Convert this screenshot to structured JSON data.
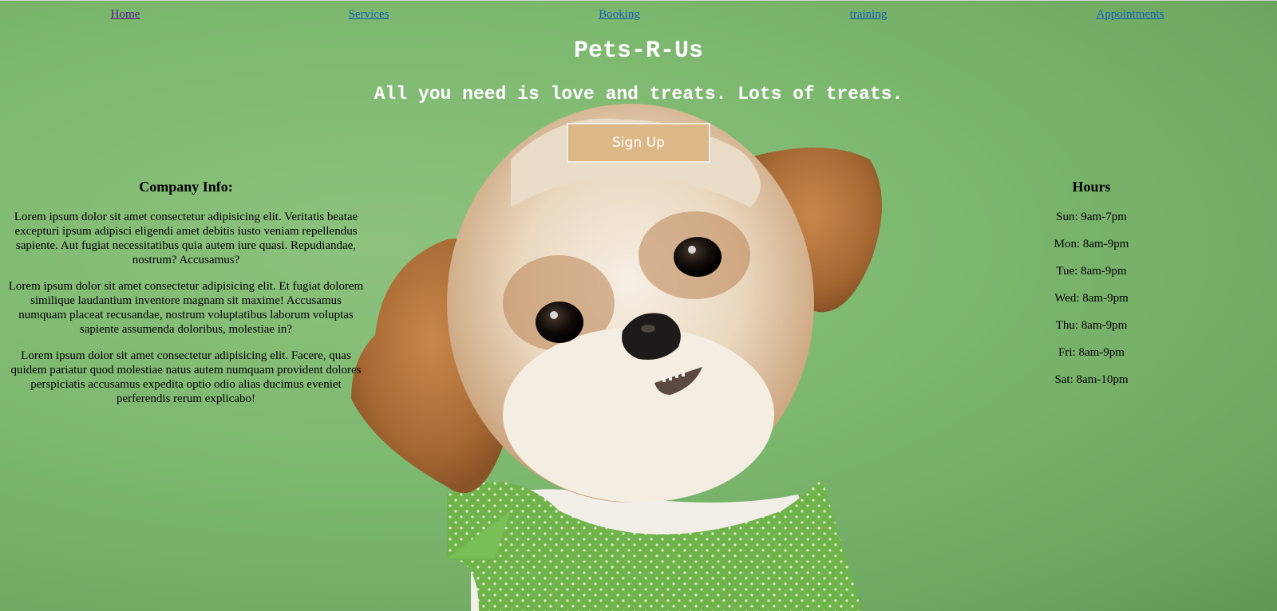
{
  "nav": [
    {
      "label": "Home",
      "visited": true
    },
    {
      "label": "Services",
      "visited": false
    },
    {
      "label": "Booking",
      "visited": false
    },
    {
      "label": "training",
      "visited": false
    },
    {
      "label": "Appointments",
      "visited": false
    }
  ],
  "hero": {
    "title": "Pets-R-Us",
    "tagline": "All you need is love and treats. Lots of treats.",
    "signup_label": "Sign Up"
  },
  "company": {
    "heading": "Company Info:",
    "paragraphs": [
      "Lorem ipsum dolor sit amet consectetur adipisicing elit. Veritatis beatae excepturi ipsum adipisci eligendi amet debitis iusto veniam repellendus sapiente. Aut fugiat necessitatibus quia autem iure quasi. Repudiandae, nostrum? Accusamus?",
      "Lorem ipsum dolor sit amet consectetur adipisicing elit. Et fugiat dolorem similique laudantium inventore magnam sit maxime! Accusamus numquam placeat recusandae, nostrum voluptatibus laborum voluptas sapiente assumenda doloribus, molestiae in?",
      "Lorem ipsum dolor sit amet consectetur adipisicing elit. Facere, quas quidem pariatur quod molestiae natus autem numquam provident dolores perspiciatis accusamus expedita optio odio alias ducimus eveniet perferendis rerum explicabo!"
    ]
  },
  "hours": {
    "heading": "Hours",
    "days": [
      "Sun: 9am-7pm",
      "Mon: 8am-9pm",
      "Tue: 8am-9pm",
      "Wed: 8am-9pm",
      "Thu: 8am-9pm",
      "Fri: 8am-9pm",
      "Sat: 8am-10pm"
    ]
  },
  "colors": {
    "background": "#7db86f",
    "button": "#dcb887",
    "link": "#1a5fb4",
    "visited_link": "#551a8b"
  },
  "background_image": "shih-tzu-dog-with-green-bandana"
}
